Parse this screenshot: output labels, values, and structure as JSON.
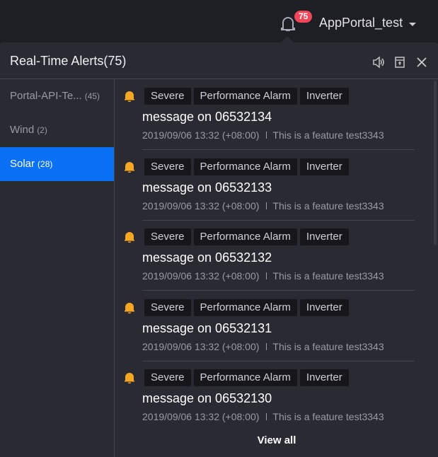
{
  "header": {
    "username": "AppPortal_test",
    "notification_count": "75"
  },
  "panel": {
    "title": "Real-Time Alerts(75)",
    "view_all": "View all"
  },
  "sidebar": {
    "items": [
      {
        "label": "Portal-API-Te...",
        "count": "(45)"
      },
      {
        "label": "Wind",
        "count": "(2)"
      },
      {
        "label": "Solar",
        "count": "(28)"
      }
    ]
  },
  "alerts": [
    {
      "tags": [
        "Severe",
        "Performance Alarm",
        "Inverter"
      ],
      "message": "message on 06532134",
      "time": "2019/09/06 13:32 (+08:00)",
      "desc": "This is a feature test3343"
    },
    {
      "tags": [
        "Severe",
        "Performance Alarm",
        "Inverter"
      ],
      "message": "message on 06532133",
      "time": "2019/09/06 13:32 (+08:00)",
      "desc": "This is a feature test3343"
    },
    {
      "tags": [
        "Severe",
        "Performance Alarm",
        "Inverter"
      ],
      "message": "message on 06532132",
      "time": "2019/09/06 13:32 (+08:00)",
      "desc": "This is a feature test3343"
    },
    {
      "tags": [
        "Severe",
        "Performance Alarm",
        "Inverter"
      ],
      "message": "message on 06532131",
      "time": "2019/09/06 13:32 (+08:00)",
      "desc": "This is a feature test3343"
    },
    {
      "tags": [
        "Severe",
        "Performance Alarm",
        "Inverter"
      ],
      "message": "message on 06532130",
      "time": "2019/09/06 13:32 (+08:00)",
      "desc": "This is a feature test3343"
    }
  ],
  "colors": {
    "accent": "#0a70f5",
    "badge": "#f0465a",
    "bell": "#f5a623"
  }
}
